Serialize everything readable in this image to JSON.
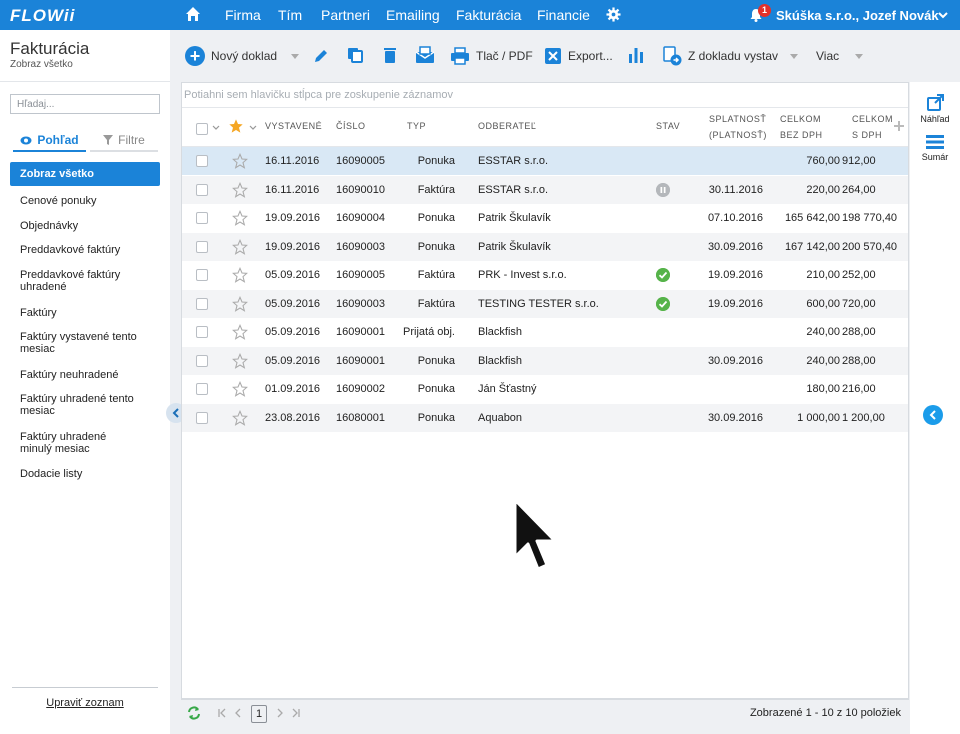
{
  "topnav": {
    "logo": "FLOWii",
    "items": [
      "Firma",
      "Tím",
      "Partneri",
      "Emailing",
      "Fakturácia",
      "Financie"
    ],
    "notifications": "1",
    "user": "Skúška s.r.o., Jozef Novák"
  },
  "sidebar": {
    "title": "Fakturácia",
    "subtitle": "Zobraz všetko",
    "search_placeholder": "Hľadaj...",
    "tab_view": "Pohľad",
    "tab_filter": "Filtre",
    "items": [
      "Zobraz všetko",
      "Cenové ponuky",
      "Objednávky",
      "Preddavkové faktúry",
      "Preddavkové faktúry uhradené",
      "Faktúry",
      "Faktúry vystavené tento mesiac",
      "Faktúry neuhradené",
      "Faktúry uhradené tento mesiac",
      "Faktúry uhradené minulý mesiac",
      "Dodacie listy"
    ],
    "edit_list": "Upraviť zoznam"
  },
  "toolbar": {
    "new_doc": "Nový doklad",
    "print_pdf": "Tlač / PDF",
    "export": "Export...",
    "from_doc": "Z dokladu vystav",
    "more": "Viac"
  },
  "grid": {
    "group_hint": "Potiahni sem hlavičku stĺpca pre zoskupenie záznamov",
    "headers": {
      "issued": "VYSTAVENÉ",
      "number": "ČÍSLO",
      "type": "TYP",
      "customer": "ODBERATEĽ",
      "status": "STAV",
      "due_1": "SPLATNOSŤ",
      "due_2": "(PLATNOSŤ)",
      "net_1": "CELKOM",
      "net_2": "BEZ DPH",
      "gross_1": "CELKOM",
      "gross_2": "S DPH"
    },
    "rows": [
      {
        "issued": "16.11.2016",
        "number": "16090005",
        "type": "Ponuka",
        "customer": "ESSTAR s.r.o.",
        "status": "",
        "due": "",
        "net": "760,00",
        "gross": "912,00"
      },
      {
        "issued": "16.11.2016",
        "number": "16090010",
        "type": "Faktúra",
        "customer": "ESSTAR s.r.o.",
        "status": "pause",
        "due": "30.11.2016",
        "net": "220,00",
        "gross": "264,00"
      },
      {
        "issued": "19.09.2016",
        "number": "16090004",
        "type": "Ponuka",
        "customer": "Patrik Škulavík",
        "status": "",
        "due": "07.10.2016",
        "net": "165 642,00",
        "gross": "198 770,40"
      },
      {
        "issued": "19.09.2016",
        "number": "16090003",
        "type": "Ponuka",
        "customer": "Patrik Škulavík",
        "status": "",
        "due": "30.09.2016",
        "net": "167 142,00",
        "gross": "200 570,40"
      },
      {
        "issued": "05.09.2016",
        "number": "16090005",
        "type": "Faktúra",
        "customer": "PRK - Invest s.r.o.",
        "status": "ok",
        "due": "19.09.2016",
        "net": "210,00",
        "gross": "252,00"
      },
      {
        "issued": "05.09.2016",
        "number": "16090003",
        "type": "Faktúra",
        "customer": "TESTING TESTER s.r.o.",
        "status": "ok",
        "due": "19.09.2016",
        "net": "600,00",
        "gross": "720,00"
      },
      {
        "issued": "05.09.2016",
        "number": "16090001",
        "type": "Prijatá obj.",
        "customer": "Blackfish",
        "status": "",
        "due": "",
        "net": "240,00",
        "gross": "288,00"
      },
      {
        "issued": "05.09.2016",
        "number": "16090001",
        "type": "Ponuka",
        "customer": "Blackfish",
        "status": "",
        "due": "30.09.2016",
        "net": "240,00",
        "gross": "288,00"
      },
      {
        "issued": "01.09.2016",
        "number": "16090002",
        "type": "Ponuka",
        "customer": "Ján Šťastný",
        "status": "",
        "due": "",
        "net": "180,00",
        "gross": "216,00"
      },
      {
        "issued": "23.08.2016",
        "number": "16080001",
        "type": "Ponuka",
        "customer": "Aquabon",
        "status": "",
        "due": "30.09.2016",
        "net": "1 000,00",
        "gross": "1 200,00"
      }
    ]
  },
  "footer": {
    "page": "1",
    "summary": "Zobrazené 1 - 10 z 10 položiek"
  },
  "rightpanel": {
    "preview": "Náhľad",
    "summary": "Sumár"
  },
  "colors": {
    "accent": "#1b83d8",
    "status_ok": "#56b34a",
    "status_pause": "#b4b7bb"
  }
}
